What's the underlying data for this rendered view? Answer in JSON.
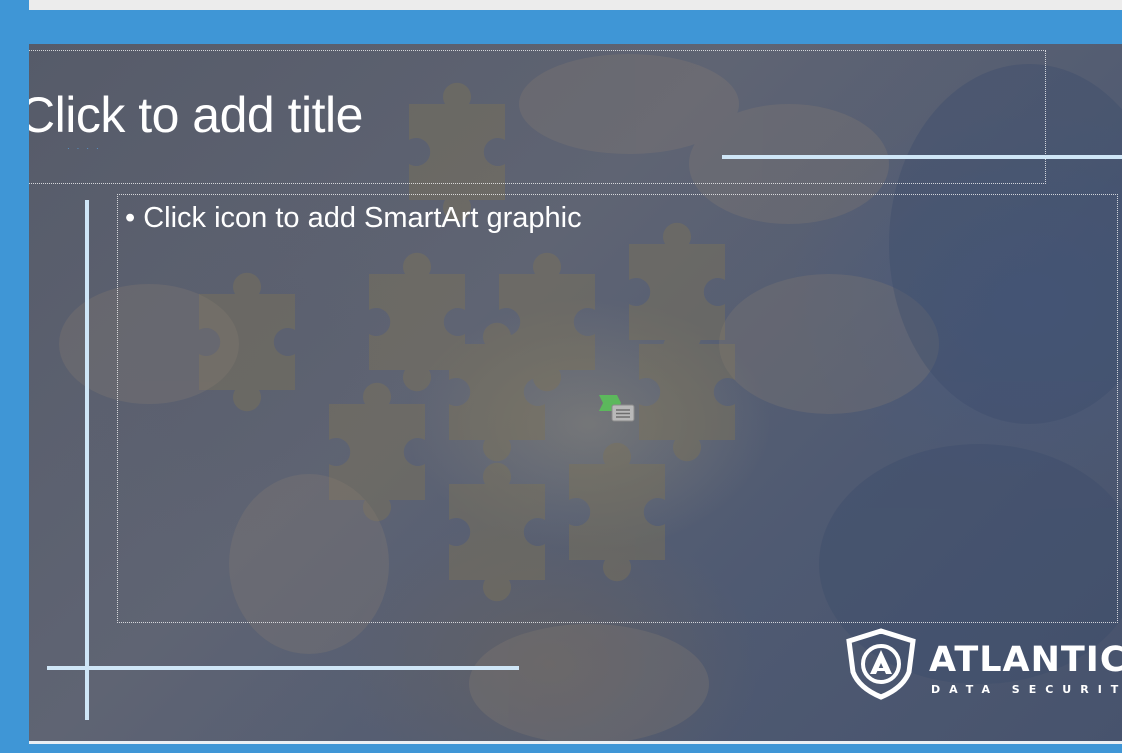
{
  "slide": {
    "title_placeholder": "Click to add title",
    "content_placeholder": "• Click icon to add SmartArt graphic"
  },
  "icons": {
    "smartart": "smartart-insert-icon",
    "logo": "shield-logo-icon"
  },
  "logo": {
    "name": "ATLANTIC",
    "tagline": "DATA SECURITY"
  },
  "colors": {
    "app_frame": "#3f96d6",
    "accent_lines": "#cfe6f7",
    "smartart_green": "#5cb85c"
  }
}
